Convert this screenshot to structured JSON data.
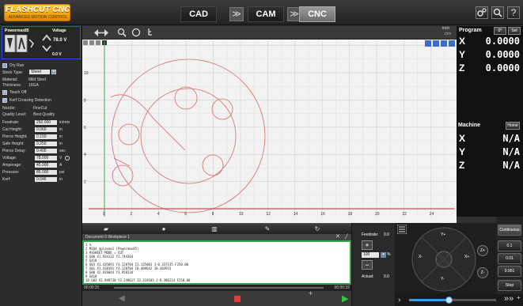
{
  "topbar": {
    "logo_main": "FLASHCUT CNC",
    "logo_sub": "ADVANCED MOTION CONTROL",
    "modes": [
      "CAD",
      "CAM",
      "CNC"
    ],
    "arrow": "≫",
    "icons": [
      "gear-icon",
      "search-icon",
      "help-icon"
    ],
    "help_glyph": "?"
  },
  "torch": {
    "name": "Powermax85",
    "voltage_label": "Voltage",
    "voltage_value": "78.0",
    "voltage_unit": "V",
    "offset_value": "0.0 V"
  },
  "settings": {
    "dry_run": "Dry Run",
    "stock_type_label": "Stock Type:",
    "stock_type_value": "Sheet",
    "material_label": "Material:",
    "material_value": "Mild Steel",
    "thickness_label": "Thickness:",
    "thickness_value": "16GA",
    "touch_off": "Touch Off",
    "kerf_detection": "Kerf Crossing Detection",
    "nozzle_label": "Nozzle:",
    "nozzle_value": "FineCut",
    "quality_label": "Quality Level:",
    "quality_value": "Best Quality",
    "params": [
      {
        "label": "Feedrate:",
        "value": "250.000",
        "unit": "in/min"
      },
      {
        "label": "Cut Height:",
        "value": "0.060",
        "unit": "in"
      },
      {
        "label": "Pierce Height:",
        "value": "0.150",
        "unit": "in"
      },
      {
        "label": "Safe Height:",
        "value": "0.250",
        "unit": "in"
      },
      {
        "label": "Pierce Delay:",
        "value": "0.400",
        "unit": "sec"
      },
      {
        "label": "Voltage:",
        "value": "78.000",
        "unit": "V"
      },
      {
        "label": "Amperage:",
        "value": "45.000",
        "unit": "A"
      },
      {
        "label": "Pressure:",
        "value": "85.000",
        "unit": "psi"
      },
      {
        "label": "Kerf:",
        "value": "0.046",
        "unit": "in"
      }
    ]
  },
  "graph": {
    "units": "inch",
    "units_sub": "mm",
    "x_ticks": [
      "0",
      "2",
      "4",
      "6",
      "8",
      "10",
      "12",
      "14",
      "16",
      "18",
      "20",
      "22",
      "24"
    ],
    "y_ticks": [
      "2",
      "4",
      "6",
      "8",
      "10"
    ]
  },
  "dro": {
    "program_label": "Program",
    "zero_btn": "0°",
    "set_btn": "Set",
    "program": [
      {
        "axis": "X",
        "value": "0.0000"
      },
      {
        "axis": "Y",
        "value": "0.0000"
      },
      {
        "axis": "Z",
        "value": "0.0000"
      }
    ],
    "machine_label": "Machine",
    "home_btn": "Home",
    "machine": [
      {
        "axis": "X",
        "value": "N/A"
      },
      {
        "axis": "Y",
        "value": "N/A"
      },
      {
        "axis": "Z",
        "value": "N/A"
      }
    ]
  },
  "gcode": {
    "header": "Document 0 Workpiece 1",
    "lines": [
      "1  %",
      "2  M104 $plasma1 (Powermax85)",
      "3  #$SHEET-MODE = CUT",
      "4  G00 X1.934132 Y2.744364",
      "5  G410",
      "6  G03 X1.435891 Y3.128704 I3.135001 J-0.337135 F250.00",
      "7  G01 X1.438391 Y3.128704 I0.409642 J0.403933",
      "8  G00 X2.926844 Y3.958134",
      "9  G410",
      "10 G03 X2.949730 Y3.249617 I3.319103 J-0.386214 F250.00"
    ],
    "time_start": "00:00:31",
    "time_end": "00:00:32"
  },
  "feedrate": {
    "label": "Feedrate:",
    "value": "0.0",
    "percent": "100",
    "percent_unit": "%",
    "actual_label": "Actual:",
    "actual_value": "0.0"
  },
  "jog": {
    "y_plus": "Y+",
    "y_minus": "Y-",
    "x_plus": "X+",
    "x_minus": "X-",
    "z_plus": "Z+",
    "z_minus": "Z-"
  },
  "steps": {
    "items": [
      "Continuous",
      "0.1",
      "0.01",
      "0.001",
      "Step"
    ]
  },
  "speed": {
    "level": 0.45,
    "arrow": "»»",
    "chevron": "›"
  }
}
